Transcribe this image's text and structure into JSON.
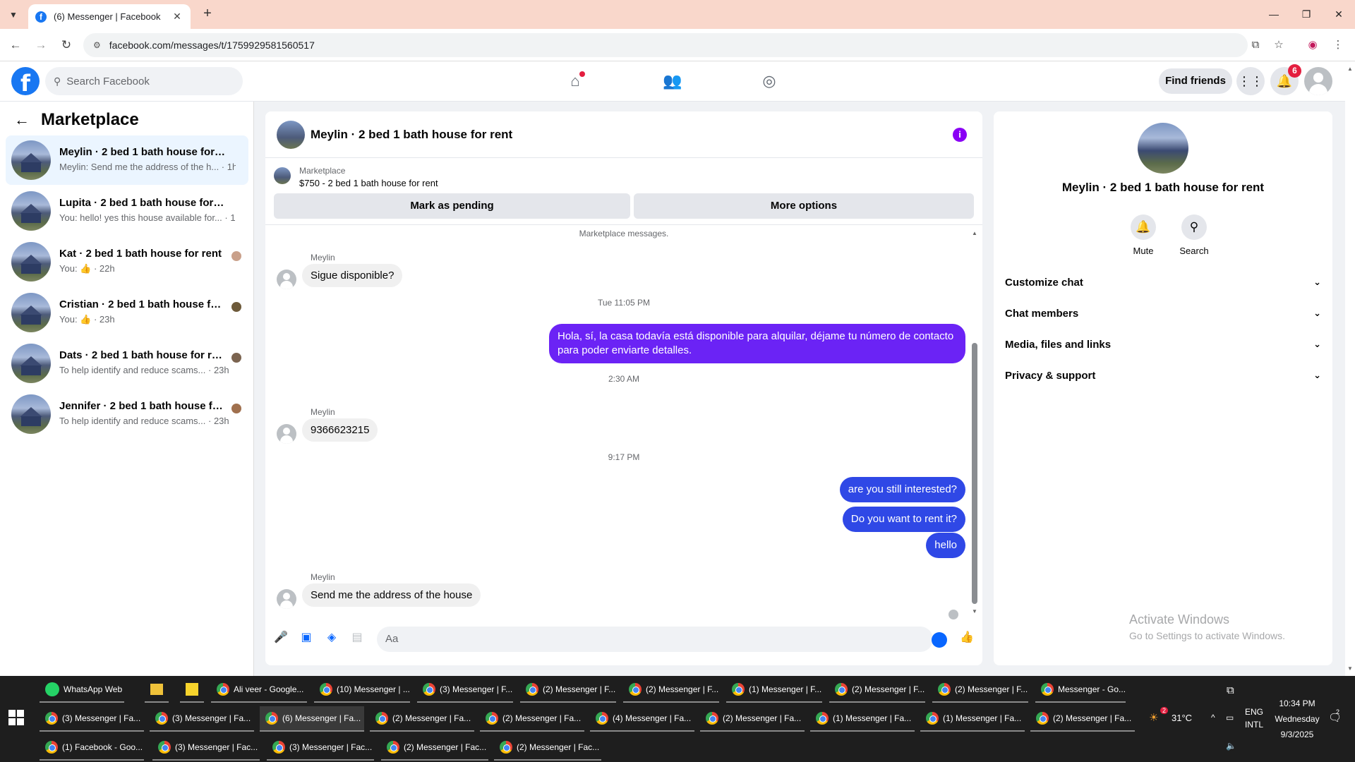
{
  "browser": {
    "tab_title": "(6) Messenger | Facebook",
    "tab_list_icon": "chevron-down",
    "new_tab": "+",
    "url": "facebook.com/messages/t/1759929581560517",
    "window_controls": [
      "—",
      "❐",
      "✕"
    ]
  },
  "fbnav": {
    "logo": "f",
    "search_placeholder": "Search Facebook",
    "find_friends": "Find friends",
    "notification_count": "6"
  },
  "sidebar": {
    "title": "Marketplace",
    "conversations": [
      {
        "title": "Meylin · 2 bed 1 bath house for rent",
        "preview": "Meylin: Send me the address of the h... · 1h",
        "active": true
      },
      {
        "title": "Lupita · 2 bed 1 bath house for rent",
        "preview": "You: hello! yes this house available for... · 1h"
      },
      {
        "title": "Kat · 2 bed 1 bath house for rent",
        "preview": "You: 👍 · 22h"
      },
      {
        "title": "Cristian · 2 bed 1 bath house for ...",
        "preview": "You: 👍 · 23h"
      },
      {
        "title": "Dats · 2 bed 1 bath house for rent",
        "preview": "To help identify and reduce scams... · 23h"
      },
      {
        "title": "Jennifer · 2 bed 1 bath house for...",
        "preview": "To help identify and reduce scams... · 23h"
      }
    ]
  },
  "chat": {
    "title": "Meylin · 2 bed 1 bath house for rent",
    "info_icon": "i",
    "marketplace_label": "Marketplace",
    "listing": "$750 - 2 bed 1 bath house for rent",
    "mark_pending": "Mark as pending",
    "more_options": "More options",
    "system_note": "Marketplace messages.",
    "messages": {
      "sender1": "Meylin",
      "m1": "Sigue disponible?",
      "ts1": "Tue 11:05 PM",
      "m2": "Hola, sí, la casa todavía está disponible para alquilar, déjame tu número de contacto para poder enviarte detalles.",
      "ts2": "2:30 AM",
      "sender2": "Meylin",
      "m3": "9366623215",
      "ts3": "9:17 PM",
      "m4": "are you still interested?",
      "m5": "Do you want to rent it?",
      "m6": "hello",
      "sender3": "Meylin",
      "m7": "Send me the address of the house"
    },
    "composer_placeholder": "Aa"
  },
  "info": {
    "title": "Meylin · 2 bed 1 bath house for rent",
    "mute": "Mute",
    "search": "Search",
    "rows": [
      "Customize chat",
      "Chat members",
      "Media, files and links",
      "Privacy & support"
    ]
  },
  "watermark": {
    "line1": "Activate Windows",
    "line2": "Go to Settings to activate Windows."
  },
  "taskbar": {
    "row1": [
      "WhatsApp Web",
      "",
      "",
      "Ali veer - Google...",
      "(10) Messenger | ...",
      "(3) Messenger | F...",
      "(2) Messenger | F...",
      "(2) Messenger | F...",
      "(1) Messenger | F...",
      "(2) Messenger | F...",
      "(2) Messenger | F...",
      "Messenger - Go..."
    ],
    "row2": [
      "(3) Messenger | Fa...",
      "(3) Messenger | Fa...",
      "(6) Messenger | Fa...",
      "(2) Messenger | Fa...",
      "(2) Messenger | Fa...",
      "(4) Messenger | Fa...",
      "(2) Messenger | Fa...",
      "(1) Messenger | Fa...",
      "(1) Messenger | Fa...",
      "(2) Messenger | Fa..."
    ],
    "row3": [
      "(1) Facebook - Goo...",
      "(3) Messenger | Fac...",
      "(3) Messenger | Fac...",
      "(2) Messenger | Fac...",
      "(2) Messenger | Fac..."
    ],
    "weather_badge": "2",
    "temperature": "31°C",
    "lang1": "ENG",
    "lang2": "INTL",
    "time": "10:34 PM",
    "day": "Wednesday",
    "date": "9/3/2025",
    "notif_count": "2"
  }
}
